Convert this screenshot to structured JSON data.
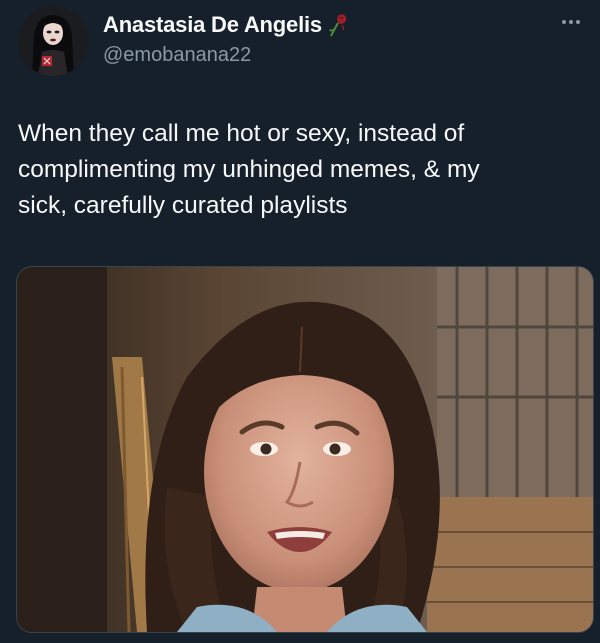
{
  "tweet": {
    "author": {
      "display_name": "Anastasia De Angelis",
      "handle": "@emobanana22",
      "avatar_icon": "gothic-woman-avatar",
      "name_emoji_icon": "wilted-rose-icon"
    },
    "more_icon": "more-options-icon",
    "text": "When they call me hot or sexy, instead of\ncomplimenting my unhinged memes, & my\nsick, carefully curated playlists",
    "media": {
      "type": "image",
      "icon": "reaction-photo"
    }
  },
  "colors": {
    "background": "#15202b",
    "primary_text": "#f7f9f9",
    "secondary_text": "#8b98a5",
    "border": "#38444d"
  }
}
